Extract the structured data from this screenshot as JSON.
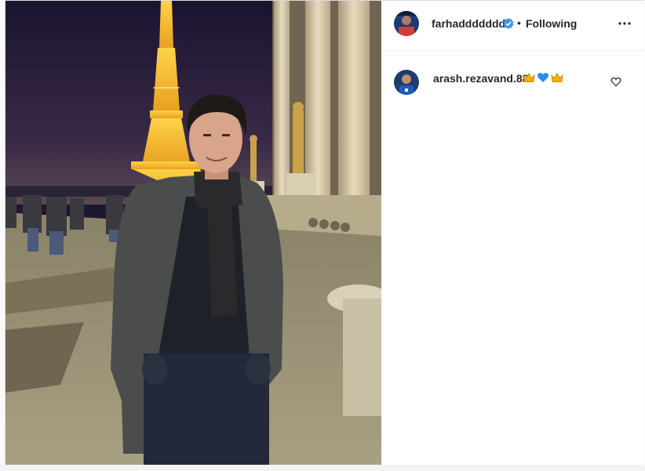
{
  "post": {
    "header": {
      "username": "farhadddddddd",
      "verified_icon": "verified-badge-icon",
      "separator": "•",
      "follow_status": "Following",
      "more_icon": "more-options-icon"
    },
    "comments": [
      {
        "username": "arash.rezavand.88",
        "emojis": [
          "crown-emoji",
          "blue-heart-emoji",
          "crown-emoji"
        ],
        "like_icon": "heart-outline-icon"
      }
    ],
    "photo": {
      "subject": "photo-of-man-at-eiffel-tower"
    }
  },
  "colors": {
    "text": "#262626",
    "verified": "#3897f0",
    "divider": "#efefef",
    "border": "#dbdbdb"
  }
}
